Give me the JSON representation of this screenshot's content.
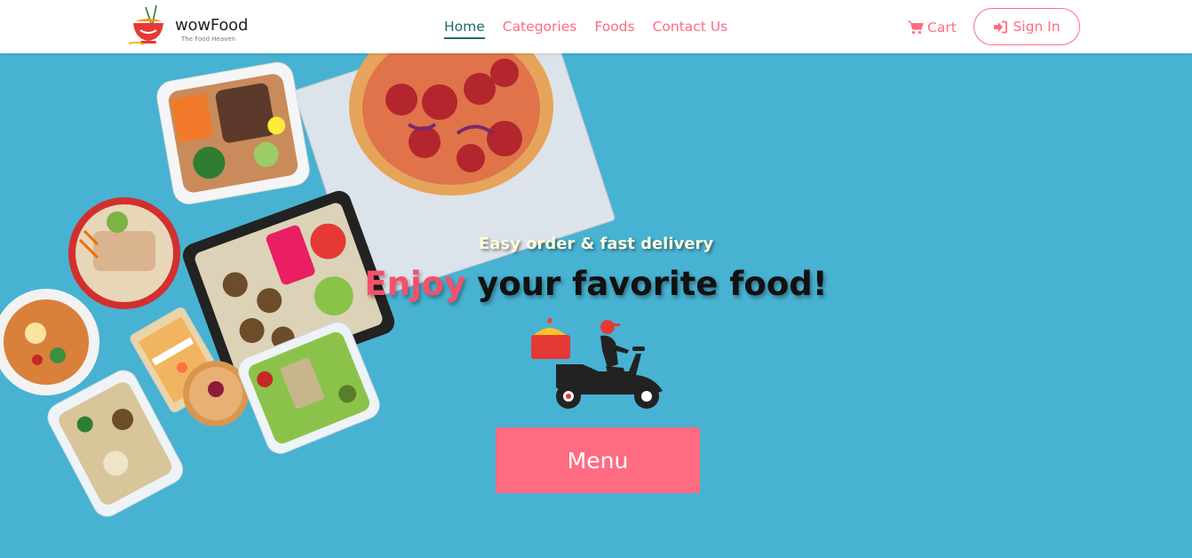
{
  "brand": {
    "name": "wowFood",
    "tagline": "The Food Heaven"
  },
  "nav": {
    "items": [
      {
        "label": "Home",
        "active": true
      },
      {
        "label": "Categories",
        "active": false
      },
      {
        "label": "Foods",
        "active": false
      },
      {
        "label": "Contact Us",
        "active": false
      }
    ],
    "cart_label": "Cart",
    "cart_icon": "shopping-cart-icon",
    "signin_label": "Sign In",
    "signin_icon": "sign-in-icon"
  },
  "hero": {
    "tagline": "Easy order & fast delivery",
    "headline_accent": "Enjoy",
    "headline_rest": " your favorite food!",
    "illustration": "delivery-scooter-icon",
    "menu_button_label": "Menu"
  },
  "colors": {
    "accent": "#ff6b81",
    "headline_accent": "#f4516c",
    "active_nav": "#1f6b6b",
    "hero_background": "#48b2d2",
    "navbar_background": "#ffffff"
  }
}
